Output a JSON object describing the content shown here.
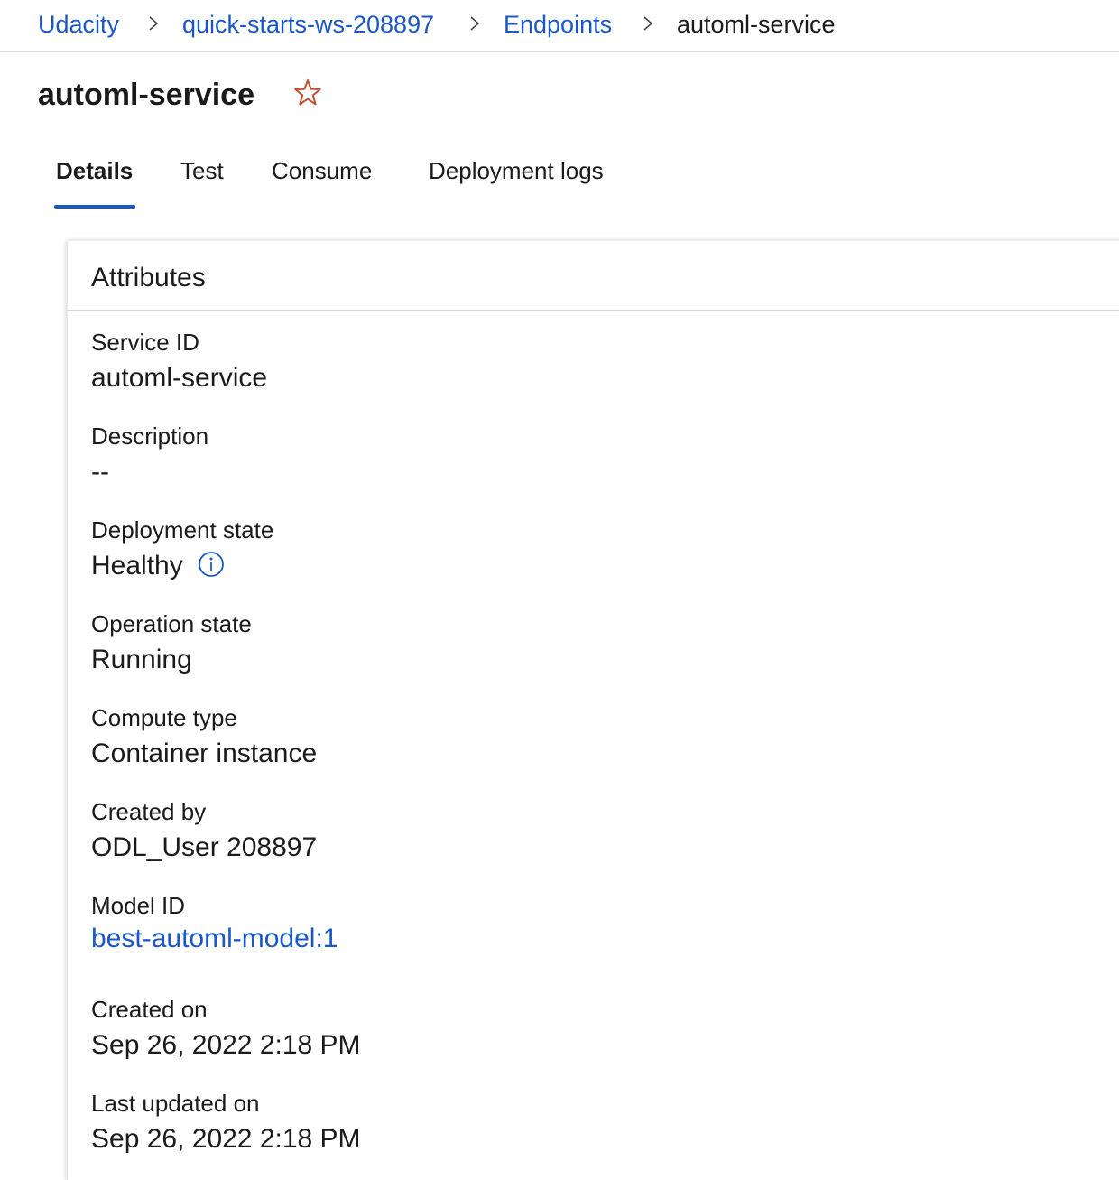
{
  "breadcrumb": {
    "items": [
      {
        "label": "Udacity"
      },
      {
        "label": "quick-starts-ws-208897"
      },
      {
        "label": "Endpoints"
      },
      {
        "label": "automl-service"
      }
    ],
    "separator_icon": "chevron-right-icon"
  },
  "header": {
    "title": "automl-service",
    "favorite_icon": "star-outline-icon"
  },
  "tabs": [
    {
      "label": "Details",
      "active": true
    },
    {
      "label": "Test",
      "active": false
    },
    {
      "label": "Consume",
      "active": false
    },
    {
      "label": "Deployment logs",
      "active": false
    }
  ],
  "attributes": {
    "title": "Attributes",
    "service_id": {
      "label": "Service ID",
      "value": "automl-service"
    },
    "description": {
      "label": "Description",
      "value": "--"
    },
    "deployment_state": {
      "label": "Deployment state",
      "value": "Healthy",
      "icon": "info-icon"
    },
    "operation_state": {
      "label": "Operation state",
      "value": "Running"
    },
    "compute_type": {
      "label": "Compute type",
      "value": "Container instance"
    },
    "created_by": {
      "label": "Created by",
      "value": "ODL_User 208897"
    },
    "model_id": {
      "label": "Model ID",
      "value": "best-automl-model:1"
    },
    "created_on": {
      "label": "Created on",
      "value": "Sep 26, 2022 2:18 PM"
    },
    "last_updated_on": {
      "label": "Last updated on",
      "value": "Sep 26, 2022 2:18 PM"
    }
  },
  "colors": {
    "link": "#1b58c7",
    "star": "#c0502f",
    "tab_underline": "#1b58c7",
    "divider": "#dcdcdc"
  }
}
